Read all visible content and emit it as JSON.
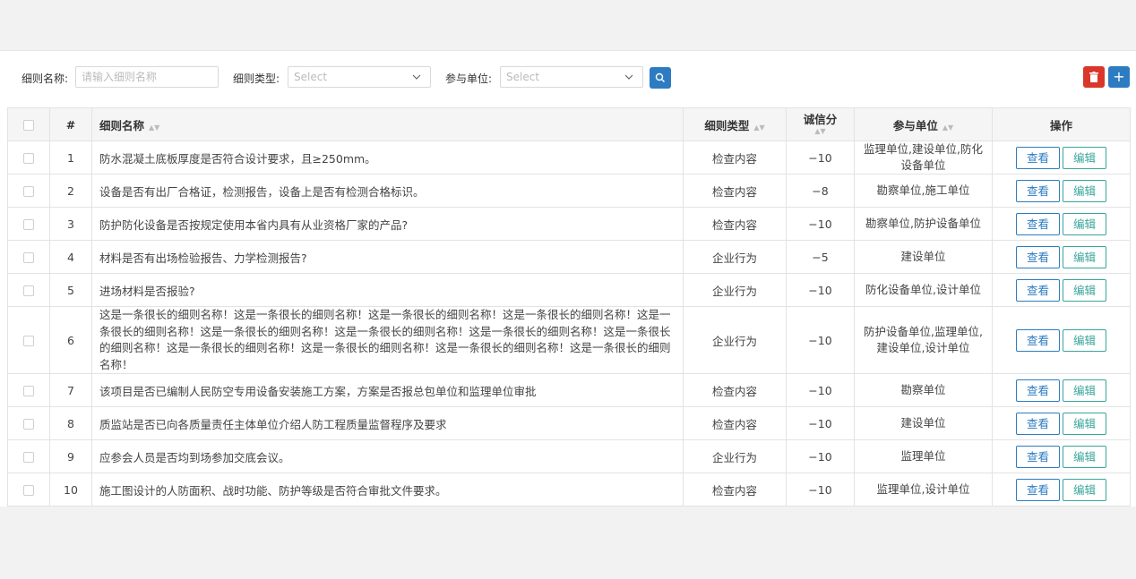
{
  "filters": {
    "name_label": "细则名称:",
    "name_placeholder": "请输入细则名称",
    "type_label": "细则类型:",
    "type_placeholder": "Select",
    "unit_label": "参与单位:",
    "unit_placeholder": "Select"
  },
  "table": {
    "headers": {
      "index": "#",
      "name": "细则名称",
      "type": "细则类型",
      "score": "诚信分",
      "units": "参与单位",
      "ops": "操作"
    },
    "view_label": "查看",
    "edit_label": "编辑",
    "rows": [
      {
        "index": "1",
        "name": "防水混凝土底板厚度是否符合设计要求，且≥250mm。",
        "type": "检查内容",
        "score": "−10",
        "units": "监理单位,建设单位,防化设备单位"
      },
      {
        "index": "2",
        "name": "设备是否有出厂合格证，检测报告，设备上是否有检测合格标识。",
        "type": "检查内容",
        "score": "−8",
        "units": "勘察单位,施工单位"
      },
      {
        "index": "3",
        "name": "防护防化设备是否按规定使用本省内具有从业资格厂家的产品?",
        "type": "检查内容",
        "score": "−10",
        "units": "勘察单位,防护设备单位"
      },
      {
        "index": "4",
        "name": "材料是否有出场检验报告、力学检测报告?",
        "type": "企业行为",
        "score": "−5",
        "units": "建设单位"
      },
      {
        "index": "5",
        "name": "进场材料是否报验?",
        "type": "企业行为",
        "score": "−10",
        "units": "防化设备单位,设计单位"
      },
      {
        "index": "6",
        "name": "这是一条很长的细则名称！这是一条很长的细则名称！这是一条很长的细则名称！这是一条很长的细则名称！这是一条很长的细则名称！这是一条很长的细则名称！这是一条很长的细则名称！这是一条很长的细则名称！这是一条很长的细则名称！这是一条很长的细则名称！这是一条很长的细则名称！这是一条很长的细则名称！这是一条很长的细则名称！",
        "type": "企业行为",
        "score": "−10",
        "units": "防护设备单位,监理单位,建设单位,设计单位"
      },
      {
        "index": "7",
        "name": "该项目是否已编制人民防空专用设备安装施工方案，方案是否报总包单位和监理单位审批",
        "type": "检查内容",
        "score": "−10",
        "units": "勘察单位"
      },
      {
        "index": "8",
        "name": "质监站是否已向各质量责任主体单位介绍人防工程质量监督程序及要求",
        "type": "检查内容",
        "score": "−10",
        "units": "建设单位"
      },
      {
        "index": "9",
        "name": "应参会人员是否均到场参加交底会议。",
        "type": "企业行为",
        "score": "−10",
        "units": "监理单位"
      },
      {
        "index": "10",
        "name": "施工图设计的人防面积、战时功能、防护等级是否符合审批文件要求。",
        "type": "检查内容",
        "score": "−10",
        "units": "监理单位,设计单位"
      }
    ]
  }
}
